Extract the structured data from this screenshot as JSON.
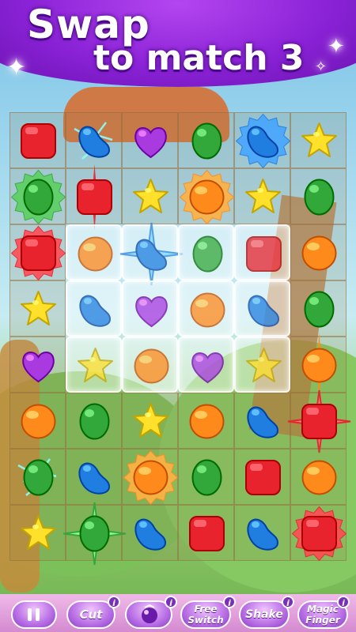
{
  "banner": {
    "line1": "Swap",
    "line2": "to match 3"
  },
  "board": {
    "rows": 8,
    "cols": 6,
    "grid": [
      [
        {
          "c": "red",
          "s": "square"
        },
        {
          "c": "blue",
          "s": "bean",
          "fx": "lightning"
        },
        {
          "c": "purple",
          "s": "heart"
        },
        {
          "c": "green",
          "s": "oval"
        },
        {
          "c": "blue",
          "s": "bean",
          "fx": "burst"
        },
        {
          "c": "yellow",
          "s": "star"
        }
      ],
      [
        {
          "c": "green",
          "s": "oval",
          "fx": "burst"
        },
        {
          "c": "red",
          "s": "square",
          "fx": "vline"
        },
        {
          "c": "yellow",
          "s": "star"
        },
        {
          "c": "orange",
          "s": "round",
          "fx": "burst"
        },
        {
          "c": "yellow",
          "s": "star"
        },
        {
          "c": "green",
          "s": "oval"
        }
      ],
      [
        {
          "c": "red",
          "s": "square",
          "fx": "burst"
        },
        {
          "c": "orange",
          "s": "round",
          "glass": true
        },
        {
          "c": "blue",
          "s": "bean",
          "glass": true,
          "fx": "cross"
        },
        {
          "c": "green",
          "s": "oval",
          "glass": true
        },
        {
          "c": "red",
          "s": "square",
          "glass": true
        },
        {
          "c": "orange",
          "s": "round"
        }
      ],
      [
        {
          "c": "yellow",
          "s": "star"
        },
        {
          "c": "blue",
          "s": "bean",
          "glass": true
        },
        {
          "c": "purple",
          "s": "heart",
          "glass": true
        },
        {
          "c": "orange",
          "s": "round",
          "glass": true
        },
        {
          "c": "blue",
          "s": "bean",
          "glass": true
        },
        {
          "c": "green",
          "s": "oval"
        }
      ],
      [
        {
          "c": "purple",
          "s": "heart"
        },
        {
          "c": "yellow",
          "s": "star",
          "glass": true
        },
        {
          "c": "orange",
          "s": "round",
          "glass": true
        },
        {
          "c": "purple",
          "s": "heart",
          "glass": true
        },
        {
          "c": "yellow",
          "s": "star",
          "glass": true
        },
        {
          "c": "orange",
          "s": "round",
          "fx": "vline"
        }
      ],
      [
        {
          "c": "orange",
          "s": "round"
        },
        {
          "c": "green",
          "s": "oval"
        },
        {
          "c": "yellow",
          "s": "star"
        },
        {
          "c": "orange",
          "s": "round"
        },
        {
          "c": "blue",
          "s": "bean"
        },
        {
          "c": "red",
          "s": "square",
          "fx": "cross"
        }
      ],
      [
        {
          "c": "green",
          "s": "oval",
          "fx": "lightning"
        },
        {
          "c": "blue",
          "s": "bean"
        },
        {
          "c": "orange",
          "s": "round",
          "fx": "burst"
        },
        {
          "c": "green",
          "s": "oval"
        },
        {
          "c": "red",
          "s": "square"
        },
        {
          "c": "orange",
          "s": "round"
        }
      ],
      [
        {
          "c": "yellow",
          "s": "star"
        },
        {
          "c": "green",
          "s": "oval",
          "fx": "cross"
        },
        {
          "c": "blue",
          "s": "bean"
        },
        {
          "c": "red",
          "s": "square"
        },
        {
          "c": "blue",
          "s": "bean"
        },
        {
          "c": "red",
          "s": "square",
          "fx": "burst"
        }
      ]
    ]
  },
  "colors": {
    "red": "#e8232d",
    "orange": "#ff8a1c",
    "yellow": "#ffe02a",
    "green": "#33a83a",
    "blue": "#1f7ee0",
    "purple": "#a83ae0",
    "banner_purple": "#8a22d6"
  },
  "toolbar": {
    "pause_icon": "pause-icon",
    "cut_label": "Cut",
    "cut_badge": "i",
    "candy_badge": "i",
    "free_switch_line1": "Free",
    "free_switch_line2": "Switch",
    "free_switch_badge": "i",
    "shake_label": "Shake",
    "shake_badge": "i",
    "magic_finger_line1": "Magic",
    "magic_finger_line2": "Finger",
    "magic_finger_badge": "i"
  }
}
